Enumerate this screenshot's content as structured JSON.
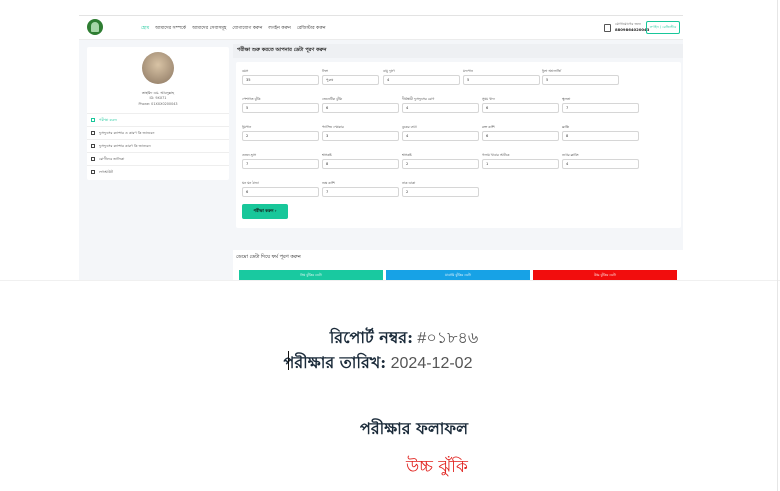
{
  "app": {
    "logo_icon": "lungs-logo-icon",
    "nav": [
      "হোম",
      "আমাদের সম্পর্কে",
      "আমাদের সেবাসমূহ",
      "যোগাযোগ করুন",
      "লগইন করুন",
      "রেজিস্টার করুন"
    ],
    "active_nav": 0,
    "call_label": "যোগাযোগের জন্য",
    "call_number": "8809864020043",
    "login_button": "লগইন / রেজিস্টার"
  },
  "profile": {
    "name": "তাহমিদ এম. আবদুল্লাহ",
    "id": "ID: 9XX71",
    "phone": "Phone: 01XXX0200043",
    "menu": [
      "পরীক্ষা করুন",
      "ফুসফুসের ক্যান্সার ও কারণ কি জানবেন",
      "ফুসফুসের ক্যান্সার কারণ কি জানবেন",
      "রোগীদের তালিকা",
      "লগআউট"
    ],
    "menu_icons": [
      "test-icon",
      "info-icon",
      "info-icon",
      "list-icon",
      "logout-icon"
    ]
  },
  "form": {
    "title": "পরীক্ষা শুরু করতে আপনার ডেটা পূরণ করুন",
    "fields": [
      {
        "label": "বয়স",
        "value": "35"
      },
      {
        "label": "লিঙ্গ",
        "value": "পুরুষ"
      },
      {
        "label": "বায়ু দূষণ",
        "value": "4"
      },
      {
        "label": "মদ্যপান",
        "value": "5"
      },
      {
        "label": "ধুলা অ্যালার্জি",
        "value": "5"
      },
      {
        "label": "পেশাগত ঝুঁকি",
        "value": "5"
      },
      {
        "label": "জেনেটিক ঝুঁকি",
        "value": "6"
      },
      {
        "label": "দীর্ঘস্থায়ী ফুসফুসের রোগ",
        "value": "4"
      },
      {
        "label": "সুষম খাদ্য",
        "value": "6"
      },
      {
        "label": "স্থূলতা",
        "value": "7"
      },
      {
        "label": "ধূমপান",
        "value": "2"
      },
      {
        "label": "প্যাসিভ স্মোকার",
        "value": "3"
      },
      {
        "label": "বুকের ব্যথা",
        "value": "4"
      },
      {
        "label": "রক্ত কাশি",
        "value": "6"
      },
      {
        "label": "ক্লান্তি",
        "value": "8"
      },
      {
        "label": "ওজন হ্রাস",
        "value": "7"
      },
      {
        "label": "শ্বাসকষ্ট",
        "value": "8"
      },
      {
        "label": "শ্বাসকষ্ট",
        "value": "2"
      },
      {
        "label": "গলায় খাবার আটকে",
        "value": "1"
      },
      {
        "label": "নখের ক্লাবিং",
        "value": "4"
      },
      {
        "label": "ঘন ঘন ঠান্ডা",
        "value": "6"
      },
      {
        "label": "শুষ্ক কাশি",
        "value": "7"
      },
      {
        "label": "নাক ডাকা",
        "value": "2"
      }
    ],
    "submit_label": "পরীক্ষা করুন ›"
  },
  "demo": {
    "title": "ডেমো ডেটা দিয়ে ফর্ম পূরণ করুন",
    "buttons": [
      {
        "label": "নিম্ন ঝুঁকির ডেটা",
        "color": "#19c9a0"
      },
      {
        "label": "মাঝারি ঝুঁকির ডেটা",
        "color": "#17a2e6"
      },
      {
        "label": "উচ্চ ঝুঁকির ডেটা",
        "color": "#f20d0d"
      }
    ]
  },
  "report": {
    "number_label": "রিপোর্ট নম্বর:",
    "number_value": " #০১৮৪৬",
    "date_label": "পরীক্ষার তারিখ:",
    "date_value": " 2024-12-02",
    "result_title": "পরীক্ষার ফলাফল",
    "risk_text": "উচ্চ ঝুঁকি",
    "risk_color": "#e0211d"
  }
}
